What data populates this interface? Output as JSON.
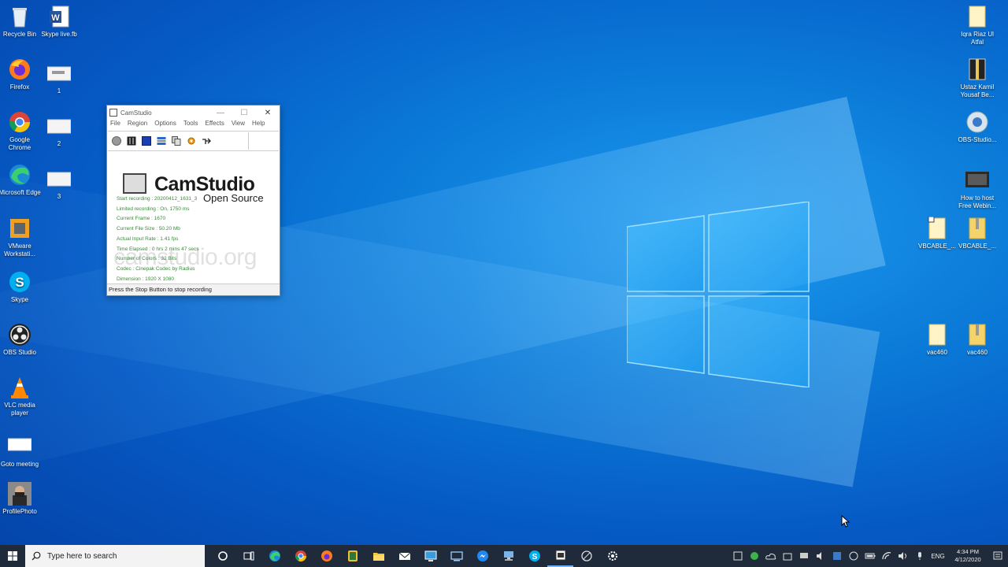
{
  "desktop": {
    "left_icons": [
      {
        "label": "Recycle Bin",
        "icon": "recycle-bin-icon"
      },
      {
        "label": "Skype live.fb",
        "icon": "word-doc-icon"
      },
      {
        "label": "Firefox",
        "icon": "firefox-icon"
      },
      {
        "label": "1",
        "icon": "image-file-icon"
      },
      {
        "label": "Google Chrome",
        "icon": "chrome-icon"
      },
      {
        "label": "2",
        "icon": "image-file-icon"
      },
      {
        "label": "Microsoft Edge",
        "icon": "edge-icon"
      },
      {
        "label": "3",
        "icon": "image-file-icon"
      },
      {
        "label": "VMware Workstati...",
        "icon": "vmware-icon"
      },
      {
        "label": "Skype",
        "icon": "skype-icon"
      },
      {
        "label": "OBS Studio",
        "icon": "obs-icon"
      },
      {
        "label": "VLC media player",
        "icon": "vlc-icon"
      },
      {
        "label": "Goto meeting",
        "icon": "goto-meeting-icon"
      },
      {
        "label": "ProfilePhoto",
        "icon": "photo-icon"
      }
    ],
    "right_icons": [
      {
        "label": "Iqra Riaz Ul Atfal",
        "icon": "folder-icon"
      },
      {
        "label": "Ustaz Kamil Yousaf Be...",
        "icon": "zip-folder-icon"
      },
      {
        "label": "OBS-Studio...",
        "icon": "installer-icon"
      },
      {
        "label": "How to host Free Webin...",
        "icon": "video-file-icon"
      },
      {
        "label": "VBCABLE_...",
        "icon": "folder-icon"
      },
      {
        "label": "VBCABLE_...",
        "icon": "zip-folder-icon"
      },
      {
        "label": "vac460",
        "icon": "folder-icon"
      },
      {
        "label": "vac460",
        "icon": "zip-folder-icon"
      }
    ]
  },
  "camstudio": {
    "title": "CamStudio",
    "menu": [
      "File",
      "Region",
      "Options",
      "Tools",
      "Effects",
      "View",
      "Help"
    ],
    "logo_title": "CamStudio",
    "logo_subtitle": "Open Source",
    "watermark": "camstudio.org",
    "stats": [
      "Start recording : 20200412_1631_3",
      "Limited recording : On, 1750 ms",
      "Current Frame : 1670",
      "Current File Size : 50.20 Mb",
      "Actual Input Rate : 1.41 fps",
      "Time Elapsed : 0 hrs 2 mins 47 secs",
      "Number of Colors : 32 Bits",
      "Codec : Cinepak Codec by Radius",
      "Dimension : 1920 X 1080"
    ],
    "status": "Press the Stop Button to stop recording"
  },
  "taskbar": {
    "search_placeholder": "Type here to search",
    "pinned": [
      "cortana-icon",
      "task-view-icon",
      "edge-icon",
      "chrome-icon",
      "firefox-icon",
      "notes-icon",
      "file-explorer-icon",
      "mail-icon",
      "remote-desktop-icon",
      "connect-icon",
      "messenger-icon",
      "network-icon",
      "skype-icon",
      "camstudio-icon",
      "snip-icon",
      "settings-icon"
    ],
    "language": "ENG",
    "time": "4:34 PM",
    "date": "4/12/2020"
  },
  "colors": {
    "accent": "#0a78d6",
    "taskbar": "#1f2a3b",
    "stats_text": "#3a8a3a"
  }
}
